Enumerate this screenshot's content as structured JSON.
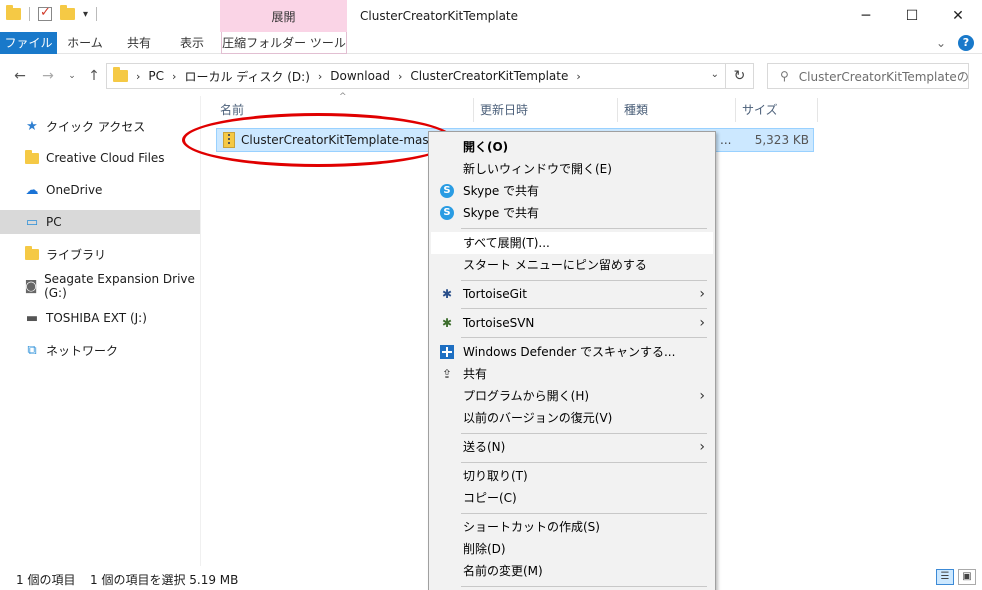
{
  "window": {
    "title": "ClusterCreatorKitTemplate",
    "context_tab_header": "展開",
    "minimize": "─",
    "maximize": "☐",
    "close": "✕"
  },
  "ribbon": {
    "tabs": [
      "ファイル",
      "ホーム",
      "共有",
      "表示",
      "圧縮フォルダー ツール"
    ],
    "help": "?",
    "collapse": "⌄"
  },
  "address": {
    "crumbs": [
      "PC",
      "ローカル ディスク (D:)",
      "Download",
      "ClusterCreatorKitTemplate"
    ],
    "search_placeholder": "ClusterCreatorKitTemplateの..."
  },
  "nav": {
    "items": [
      {
        "label": "クイック アクセス",
        "icon": "star-icon"
      },
      {
        "label": "Creative Cloud Files",
        "icon": "creative-cloud-icon"
      },
      {
        "label": "OneDrive",
        "icon": "cloud-icon"
      },
      {
        "label": "PC",
        "icon": "computer-icon"
      },
      {
        "label": "ライブラリ",
        "icon": "library-icon"
      },
      {
        "label": "Seagate Expansion Drive (G:)",
        "icon": "drive-icon"
      },
      {
        "label": "TOSHIBA EXT (J:)",
        "icon": "usb-drive-icon"
      },
      {
        "label": "ネットワーク",
        "icon": "network-icon"
      }
    ],
    "selected_index": 3
  },
  "columns": [
    "名前",
    "更新日時",
    "種類",
    "サイズ"
  ],
  "file": {
    "name": "ClusterCreatorKitTemplate-master.zip",
    "type_truncated": "...",
    "size": "5,323 KB"
  },
  "context_menu": {
    "items": [
      {
        "label": "開く(O)",
        "bold": true
      },
      {
        "label": "新しいウィンドウで開く(E)"
      },
      {
        "label": "Skype で共有",
        "icon": "skype-icon"
      },
      {
        "label": "Skype で共有",
        "icon": "skype-icon"
      },
      {
        "label": "すべて展開(T)...",
        "highlight": true
      },
      {
        "label": "スタート メニューにピン留めする"
      },
      {
        "label": "TortoiseGit",
        "icon": "tortoisegit-icon",
        "submenu": true
      },
      {
        "label": "TortoiseSVN",
        "icon": "tortoisesvn-icon",
        "submenu": true
      },
      {
        "label": "Windows Defender でスキャンする...",
        "icon": "defender-icon"
      },
      {
        "label": "共有",
        "icon": "share-icon"
      },
      {
        "label": "プログラムから開く(H)",
        "submenu": true
      },
      {
        "label": "以前のバージョンの復元(V)"
      },
      {
        "label": "送る(N)",
        "submenu": true
      },
      {
        "label": "切り取り(T)"
      },
      {
        "label": "コピー(C)"
      },
      {
        "label": "ショートカットの作成(S)"
      },
      {
        "label": "削除(D)"
      },
      {
        "label": "名前の変更(M)"
      }
    ]
  },
  "status": {
    "count": "1 個の項目",
    "selection": "1 個の項目を選択  5.19 MB"
  },
  "colors": {
    "accent": "#1979ca",
    "context_tab": "#fad4e6",
    "selection": "#cce8ff",
    "annotation": "#e00000"
  }
}
